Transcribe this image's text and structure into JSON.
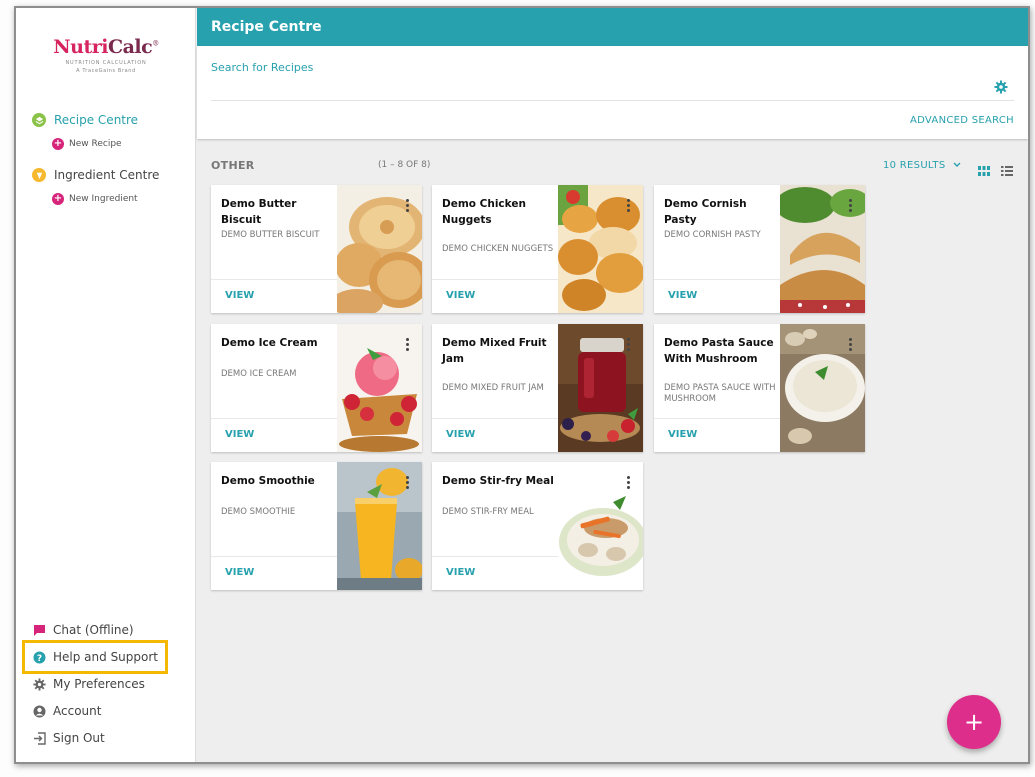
{
  "brand": {
    "logo_nutri": "Nutri",
    "logo_calc": "Calc",
    "logo_reg": "®",
    "logo_sub": "NUTRITION CALCULATION",
    "logo_brand": "A TraceGains Brand"
  },
  "sidebar": {
    "recipe_centre": "Recipe Centre",
    "new_recipe": "New Recipe",
    "ingredient_centre": "Ingredient Centre",
    "new_ingredient": "New Ingredient",
    "bottom": [
      {
        "label": "Chat (Offline)",
        "icon": "chat-icon"
      },
      {
        "label": "Help and Support",
        "icon": "help-icon"
      },
      {
        "label": "My Preferences",
        "icon": "gear-icon"
      },
      {
        "label": "Account",
        "icon": "account-icon"
      },
      {
        "label": "Sign Out",
        "icon": "sign-out-icon"
      }
    ]
  },
  "header": {
    "title": "Recipe Centre",
    "search_label": "Search for Recipes",
    "advanced_search": "ADVANCED SEARCH"
  },
  "results": {
    "section": "OTHER",
    "range": "(1 – 8 OF 8)",
    "count_label": "10 RESULTS"
  },
  "cards": [
    {
      "title": "Demo Butter Biscuit",
      "subtitle": "DEMO BUTTER BISCUIT",
      "view": "VIEW"
    },
    {
      "title": "Demo Chicken Nuggets",
      "subtitle": "DEMO CHICKEN NUGGETS",
      "view": "VIEW"
    },
    {
      "title": "Demo Cornish Pasty",
      "subtitle": "DEMO CORNISH PASTY",
      "view": "VIEW"
    },
    {
      "title": "Demo Ice Cream",
      "subtitle": "DEMO ICE CREAM",
      "view": "VIEW"
    },
    {
      "title": "Demo Mixed Fruit Jam",
      "subtitle": "DEMO MIXED FRUIT JAM",
      "view": "VIEW"
    },
    {
      "title": "Demo Pasta Sauce With Mushroom",
      "subtitle": "DEMO PASTA SAUCE WITH MUSHROOM",
      "view": "VIEW"
    },
    {
      "title": "Demo Smoothie",
      "subtitle": "DEMO SMOOTHIE",
      "view": "VIEW"
    },
    {
      "title": "Demo Stir-fry Meal",
      "subtitle": "DEMO STIR-FRY MEAL",
      "view": "VIEW"
    }
  ],
  "fab": {
    "label": "+"
  },
  "colors": {
    "accent": "#27a1ad",
    "brand": "#d6245f",
    "fab": "#dc2e8a",
    "highlight": "#f5b800"
  }
}
